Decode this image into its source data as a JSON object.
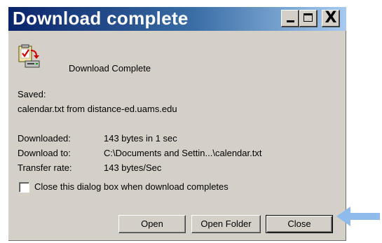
{
  "window": {
    "title": "Download complete",
    "buttons": {
      "minimize": "minimize",
      "maximize": "maximize",
      "close": "X"
    }
  },
  "status": {
    "message": "Download Complete",
    "icon": "download-complete-icon"
  },
  "saved": {
    "label": "Saved:",
    "value": "calendar.txt from distance-ed.uams.edu"
  },
  "details": {
    "downloaded_label": "Downloaded:",
    "downloaded_value": "143 bytes in 1 sec",
    "download_to_label": "Download to:",
    "download_to_value": "C:\\Documents and Settin...\\calendar.txt",
    "transfer_rate_label": "Transfer rate:",
    "transfer_rate_value": "143 bytes/Sec"
  },
  "option": {
    "close_when_complete_label": "Close this dialog box when download completes",
    "checked": false
  },
  "actions": {
    "open_label": "Open",
    "open_folder_label": "Open Folder",
    "close_label": "Close"
  },
  "colors": {
    "title_gradient_start": "#0a246a",
    "title_gradient_end": "#a6caf0",
    "dialog_bg": "#d4d0c8",
    "pointer_arrow": "#8fbbea"
  }
}
